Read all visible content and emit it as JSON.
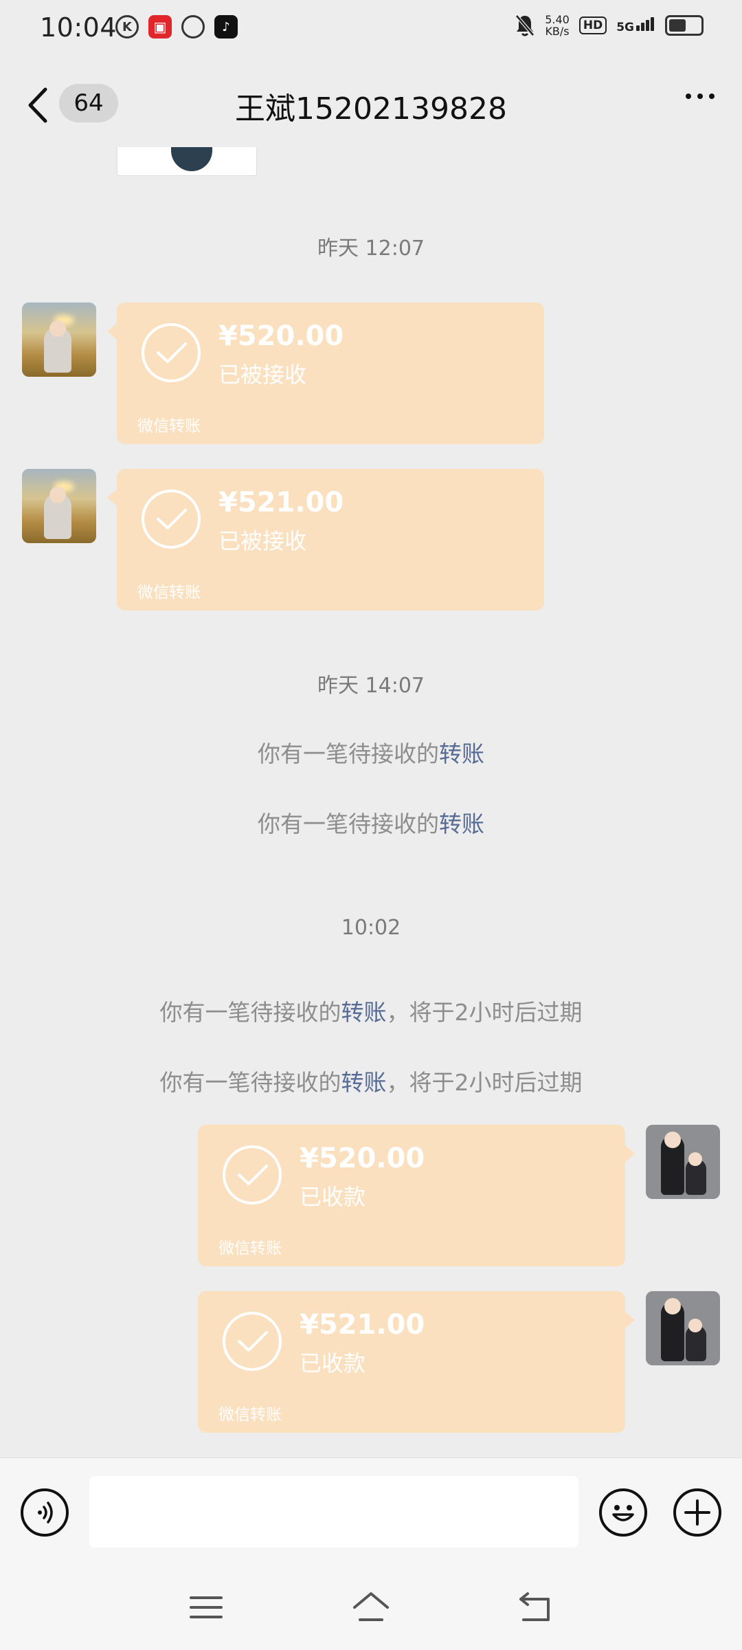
{
  "status_bar": {
    "time": "10:04",
    "network_speed_value": "5.40",
    "network_speed_unit": "KB/s",
    "hd": "HD",
    "signal": "5G",
    "battery_level": 0.55
  },
  "header": {
    "unread_count": "64",
    "title": "王斌15202139828"
  },
  "chat": {
    "timestamps": [
      "昨天 12:07",
      "昨天 14:07",
      "10:02"
    ],
    "transfers": [
      {
        "amount": "¥520.00",
        "status": "已被接收",
        "footer": "微信转账",
        "side": "left"
      },
      {
        "amount": "¥521.00",
        "status": "已被接收",
        "footer": "微信转账",
        "side": "left"
      },
      {
        "amount": "¥520.00",
        "status": "已收款",
        "footer": "微信转账",
        "side": "right"
      },
      {
        "amount": "¥521.00",
        "status": "已收款",
        "footer": "微信转账",
        "side": "right"
      }
    ],
    "system_messages": [
      {
        "text": "你有一笔待接收的",
        "link": "转账",
        "suffix": ""
      },
      {
        "text": "你有一笔待接收的",
        "link": "转账",
        "suffix": ""
      },
      {
        "text": "你有一笔待接收的",
        "link": "转账",
        "suffix": "，将于2小时后过期"
      },
      {
        "text": "你有一笔待接收的",
        "link": "转账",
        "suffix": "，将于2小时后过期"
      }
    ]
  },
  "input": {
    "value": "",
    "placeholder": ""
  },
  "icons": {
    "back": "chevron-left-icon",
    "more": "more-dots-icon",
    "voice": "voice-icon",
    "emoji": "emoji-icon",
    "plus": "plus-icon",
    "check": "check-icon"
  }
}
